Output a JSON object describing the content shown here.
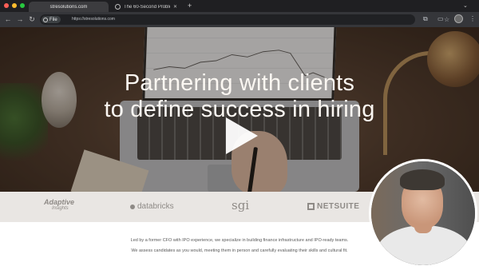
{
  "browser": {
    "tabs": [
      {
        "title": "stresolutions.com",
        "active": true
      },
      {
        "title": "The 60-Second Problem — …",
        "active": false
      }
    ],
    "new_tab_label": "+",
    "nav": {
      "back": "←",
      "forward": "→",
      "reload": "↻"
    },
    "omnibox": {
      "chip_label": "File",
      "url": "https://stresolutions.com"
    },
    "icons": [
      "bookmark-star-icon",
      "extensions-icon",
      "profile-avatar",
      "menu-kebab-icon"
    ]
  },
  "hero": {
    "headline_line1": "Partnering with clients",
    "headline_line2": "to define success in hiring",
    "play_button": "play-icon"
  },
  "logos": {
    "adaptive": "Adaptive",
    "adaptive_sub": "Insights",
    "databricks": "databricks",
    "sgi": "sgi",
    "netsuite": "NETSUITE"
  },
  "content": {
    "paragraph1": "Led by a former CFO with IPO experience, we specialize in building finance infrastructure and IPO-ready teams.",
    "paragraph2": "We assess candidates as you would, meeting them in person and carefully evaluating their skills and cultural fit."
  },
  "colors": {
    "tab_bar": "#1f1f22",
    "toolbar": "#35363a",
    "logo_strip": "#e9e6e3",
    "headline": "#fbf7f2"
  }
}
